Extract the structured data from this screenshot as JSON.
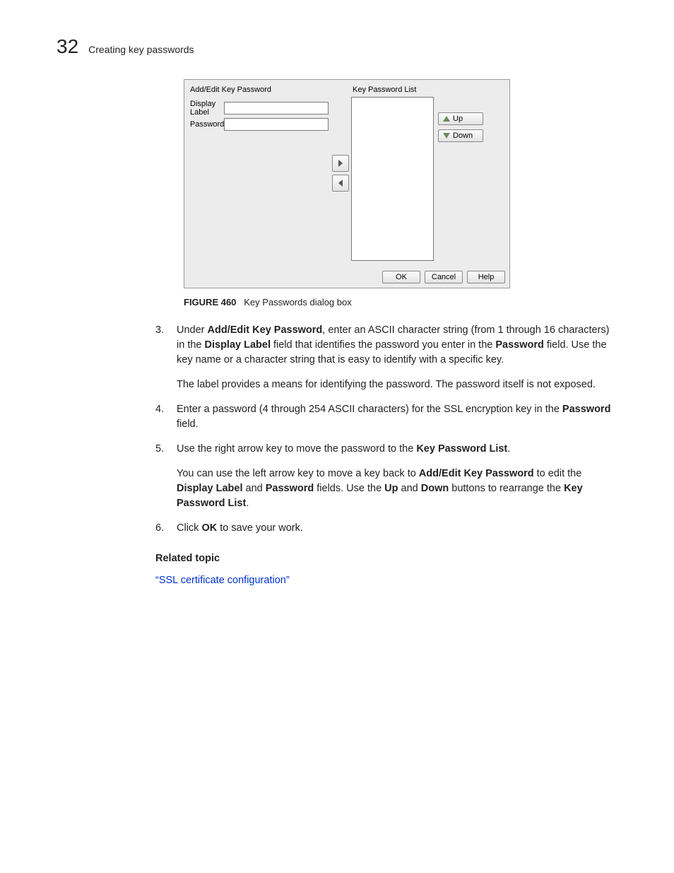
{
  "header": {
    "chapter_number": "32",
    "chapter_title": "Creating key passwords"
  },
  "dialog": {
    "left_panel_title": "Add/Edit Key Password",
    "display_label_text": "Display Label",
    "password_label_text": "Password",
    "display_label_value": "",
    "password_value": "",
    "right_panel_title": "Key Password List",
    "up_button": "Up",
    "down_button": "Down",
    "ok_button": "OK",
    "cancel_button": "Cancel",
    "help_button": "Help"
  },
  "figure": {
    "label": "FIGURE 460",
    "caption": "Key Passwords dialog box"
  },
  "steps": {
    "s3": {
      "num": "3.",
      "p1_a": "Under ",
      "p1_b": "Add/Edit Key Password",
      "p1_c": ", enter an ASCII character string (from 1 through 16 characters) in the ",
      "p1_d": "Display Label",
      "p1_e": " field that identifies the password you enter in the ",
      "p1_f": "Password",
      "p1_g": " field. Use the key name or a character string that is easy to identify with a specific key.",
      "p2": "The label provides a means for identifying the password. The password itself is not exposed."
    },
    "s4": {
      "num": "4.",
      "p1_a": "Enter a password (4 through 254 ASCII characters) for the SSL encryption key in the ",
      "p1_b": "Password",
      "p1_c": " field."
    },
    "s5": {
      "num": "5.",
      "p1_a": "Use the right arrow key to move the password to the ",
      "p1_b": "Key Password List",
      "p1_c": ".",
      "p2_a": "You can use the left arrow key to move a key back to ",
      "p2_b": "Add/Edit Key Password",
      "p2_c": " to edit the ",
      "p2_d": "Display Label",
      "p2_e": " and ",
      "p2_f": "Password",
      "p2_g": " fields. Use the ",
      "p2_h": "Up",
      "p2_i": " and ",
      "p2_j": "Down",
      "p2_k": " buttons to rearrange the ",
      "p2_l": "Key Password List",
      "p2_m": "."
    },
    "s6": {
      "num": "6.",
      "p1_a": "Click ",
      "p1_b": "OK",
      "p1_c": " to save your work."
    }
  },
  "related": {
    "heading": "Related topic",
    "link_text": "“SSL certificate configuration”"
  }
}
